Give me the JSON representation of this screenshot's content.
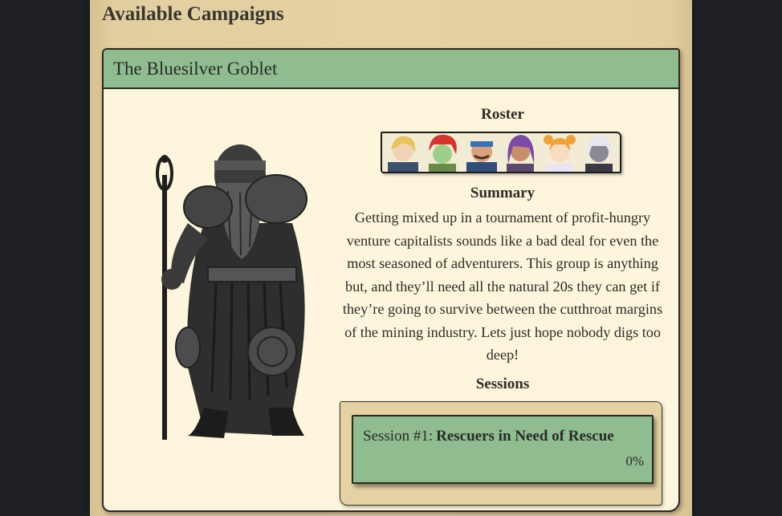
{
  "page": {
    "title": "Available Campaigns"
  },
  "campaign": {
    "title": "The Bluesilver Goblet",
    "portrait_icon": "armored-dwarf-with-staff",
    "roster_label": "Roster",
    "roster": [
      {
        "icon": "blonde-adventurer-avatar"
      },
      {
        "icon": "red-haired-goblin-avatar"
      },
      {
        "icon": "mustached-bandana-avatar"
      },
      {
        "icon": "purple-haired-woman-avatar"
      },
      {
        "icon": "orange-pigtails-girl-avatar"
      },
      {
        "icon": "white-haired-elf-avatar"
      }
    ],
    "summary_label": "Summary",
    "summary": "Getting mixed up in a tournament of profit-hungry venture capitalists sounds like a bad deal for even the most seasoned of adventurers. This group is anything but, and they’ll need all the natural 20s they can get if they’re going to survive between the cutthroat margins of the mining industry. Lets just hope nobody digs too deep!",
    "sessions_label": "Sessions",
    "sessions": [
      {
        "prefix": "Session #1:",
        "name": "Rescuers in Need of Rescue",
        "progress": "0%"
      }
    ]
  },
  "colors": {
    "background": "#1f2126",
    "parchment": "#e4d2a4",
    "card": "#fdf6dc",
    "header_green": "#8fbd8f",
    "ink": "#2b2824"
  }
}
